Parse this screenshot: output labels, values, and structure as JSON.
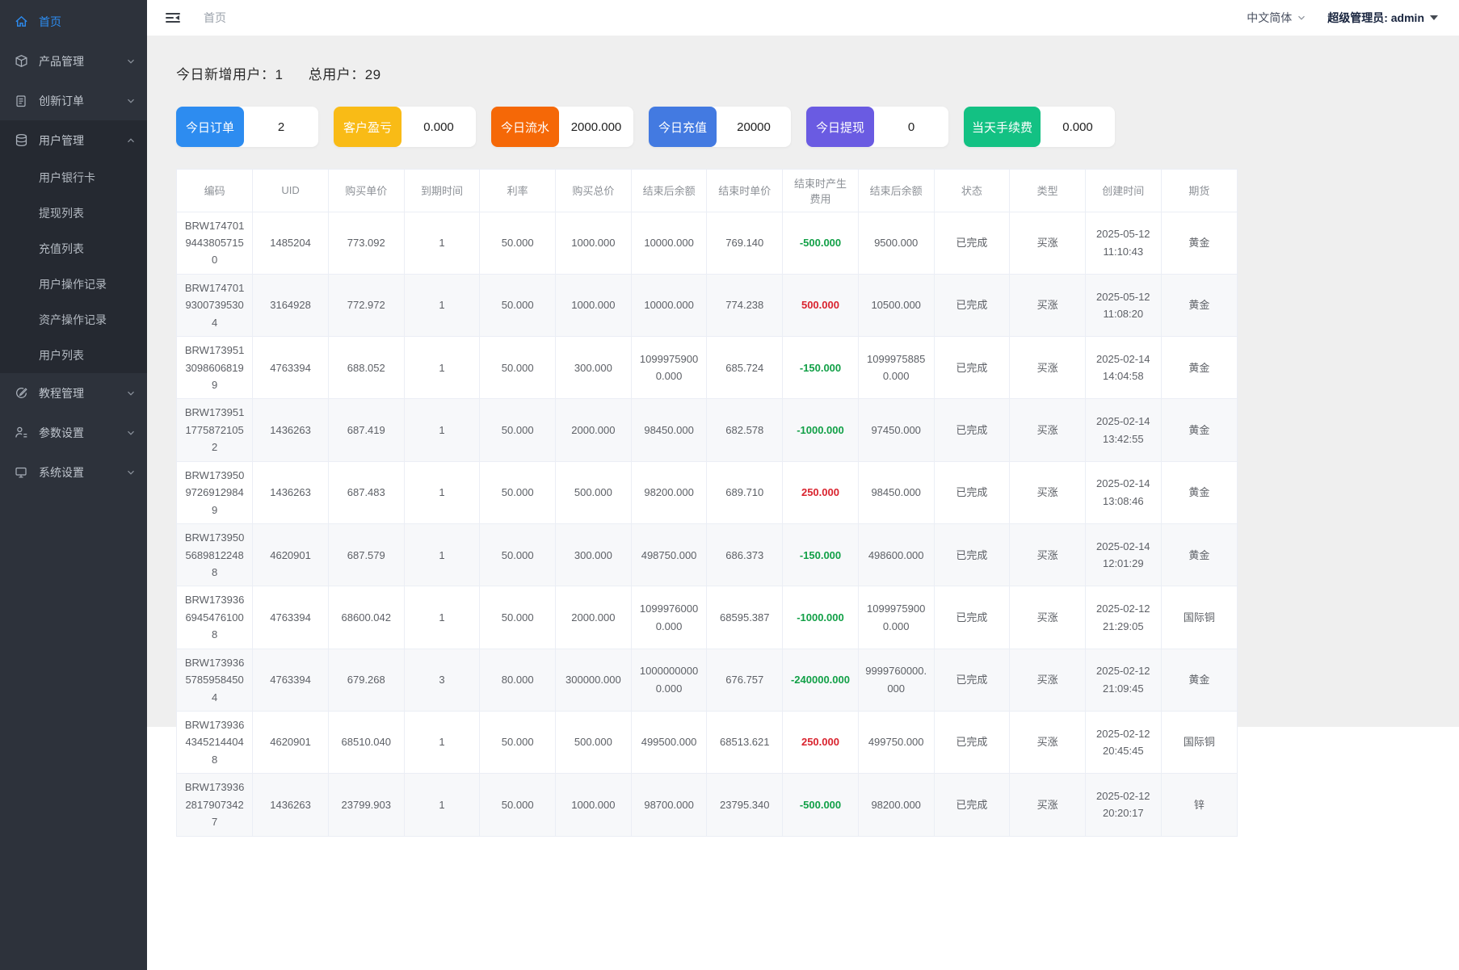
{
  "sidebar": {
    "items": [
      {
        "label": "首页",
        "icon": "home-icon",
        "active": true
      },
      {
        "label": "产品管理",
        "icon": "product-icon",
        "chevron": "down"
      },
      {
        "label": "创新订单",
        "icon": "order-icon",
        "chevron": "down"
      },
      {
        "label": "用户管理",
        "icon": "users-icon",
        "chevron": "up",
        "expanded": true,
        "children": [
          "用户银行卡",
          "提现列表",
          "充值列表",
          "用户操作记录",
          "资产操作记录",
          "用户列表"
        ]
      },
      {
        "label": "教程管理",
        "icon": "tutorial-icon",
        "chevron": "down"
      },
      {
        "label": "参数设置",
        "icon": "params-icon",
        "chevron": "down"
      },
      {
        "label": "系统设置",
        "icon": "system-icon",
        "chevron": "down"
      }
    ]
  },
  "topbar": {
    "breadcrumb": "首页",
    "language": "中文简体",
    "account": "超级管理员: admin"
  },
  "stats": {
    "new_users_label": "今日新增用户：",
    "new_users_value": "1",
    "total_users_label": "总用户：",
    "total_users_value": "29"
  },
  "cards": [
    {
      "name": "today-orders",
      "label": "今日订单",
      "value": "2",
      "color": "#2d8cf0"
    },
    {
      "name": "customer-pnl",
      "label": "客户盈亏",
      "value": "0.000",
      "color": "#f9bb16"
    },
    {
      "name": "today-turnover",
      "label": "今日流水",
      "value": "2000.000",
      "color": "#f56807"
    },
    {
      "name": "today-deposit",
      "label": "今日充值",
      "value": "20000",
      "color": "#437ae1"
    },
    {
      "name": "today-withdraw",
      "label": "今日提现",
      "value": "0",
      "color": "#6a5be2"
    },
    {
      "name": "today-fee",
      "label": "当天手续费",
      "value": "0.000",
      "color": "#13c183"
    }
  ],
  "table": {
    "fee_column_index": 8,
    "colors": {
      "fee_negative": "#12a047",
      "fee_positive": "#d9232e"
    },
    "columns": [
      "编码",
      "UID",
      "购买单价",
      "到期时间",
      "利率",
      "购买总价",
      "结束后余额",
      "结束时单价",
      "结束时产生费用",
      "结束后余额",
      "状态",
      "类型",
      "创建时间",
      "期货"
    ],
    "rows": [
      [
        "BRW17470194438057150",
        "1485204",
        "773.092",
        "1",
        "50.000",
        "1000.000",
        "10000.000",
        "769.140",
        "-500.000",
        "9500.000",
        "已完成",
        "买涨",
        "2025-05-12 11:10:43",
        "黄金"
      ],
      [
        "BRW17470193007395304",
        "3164928",
        "772.972",
        "1",
        "50.000",
        "1000.000",
        "10000.000",
        "774.238",
        "500.000",
        "10500.000",
        "已完成",
        "买涨",
        "2025-05-12 11:08:20",
        "黄金"
      ],
      [
        "BRW17395130986068199",
        "4763394",
        "688.052",
        "1",
        "50.000",
        "300.000",
        "10999759000.000",
        "685.724",
        "-150.000",
        "10999758850.000",
        "已完成",
        "买涨",
        "2025-02-14 14:04:58",
        "黄金"
      ],
      [
        "BRW17395117758721052",
        "1436263",
        "687.419",
        "1",
        "50.000",
        "2000.000",
        "98450.000",
        "682.578",
        "-1000.000",
        "97450.000",
        "已完成",
        "买涨",
        "2025-02-14 13:42:55",
        "黄金"
      ],
      [
        "BRW17395097269129849",
        "1436263",
        "687.483",
        "1",
        "50.000",
        "500.000",
        "98200.000",
        "689.710",
        "250.000",
        "98450.000",
        "已完成",
        "买涨",
        "2025-02-14 13:08:46",
        "黄金"
      ],
      [
        "BRW17395056898122488",
        "4620901",
        "687.579",
        "1",
        "50.000",
        "300.000",
        "498750.000",
        "686.373",
        "-150.000",
        "498600.000",
        "已完成",
        "买涨",
        "2025-02-14 12:01:29",
        "黄金"
      ],
      [
        "BRW17393669454761008",
        "4763394",
        "68600.042",
        "1",
        "50.000",
        "2000.000",
        "10999760000.000",
        "68595.387",
        "-1000.000",
        "10999759000.000",
        "已完成",
        "买涨",
        "2025-02-12 21:29:05",
        "国际铜"
      ],
      [
        "BRW17393657859584504",
        "4763394",
        "679.268",
        "3",
        "80.000",
        "300000.000",
        "10000000000.000",
        "676.757",
        "-240000.000",
        "9999760000.000",
        "已完成",
        "买涨",
        "2025-02-12 21:09:45",
        "黄金"
      ],
      [
        "BRW17393643452144048",
        "4620901",
        "68510.040",
        "1",
        "50.000",
        "500.000",
        "499500.000",
        "68513.621",
        "250.000",
        "499750.000",
        "已完成",
        "买涨",
        "2025-02-12 20:45:45",
        "国际铜"
      ],
      [
        "BRW17393628179073427",
        "1436263",
        "23799.903",
        "1",
        "50.000",
        "1000.000",
        "98700.000",
        "23795.340",
        "-500.000",
        "98200.000",
        "已完成",
        "买涨",
        "2025-02-12 20:20:17",
        "锌"
      ]
    ]
  }
}
